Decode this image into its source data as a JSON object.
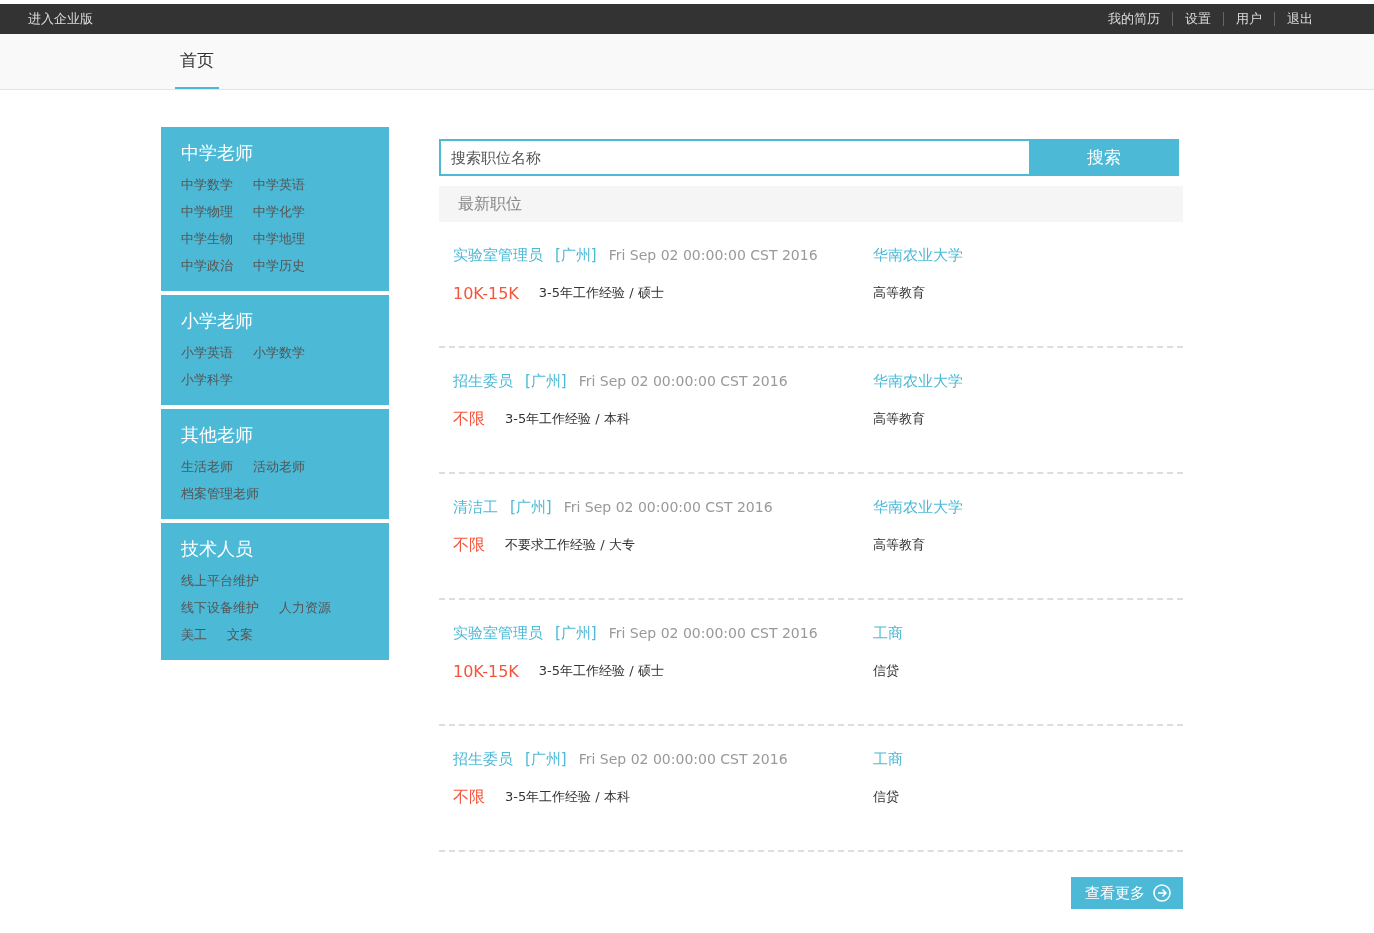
{
  "top_bar": {
    "left_link": "进入企业版",
    "links": [
      "我的简历",
      "设置",
      "用户",
      "退出"
    ]
  },
  "nav_tabs": [
    {
      "label": "首页",
      "selected": true
    }
  ],
  "categories": [
    {
      "title": "中学老师",
      "lines": [
        {
          "links": [
            "中学数学",
            "中学英语"
          ]
        },
        {
          "links": [
            "中学物理",
            "中学化学"
          ]
        },
        {
          "links": [
            "中学生物",
            "中学地理"
          ]
        },
        {
          "links": [
            "中学政治",
            "中学历史"
          ]
        }
      ]
    },
    {
      "title": "小学老师",
      "lines": [
        {
          "links": [
            "小学英语",
            "小学数学"
          ]
        },
        {
          "links": [
            "小学科学"
          ]
        }
      ]
    },
    {
      "title": "其他老师",
      "lines": [
        {
          "links": [
            "生活老师",
            "活动老师"
          ]
        },
        {
          "links": [
            "档案管理老师"
          ]
        }
      ]
    },
    {
      "title": "技术人员",
      "lines": [
        {
          "links": [
            "线上平台维护"
          ]
        },
        {
          "links": [
            "线下设备维护",
            "人力资源"
          ]
        },
        {
          "links": [
            "美工",
            "文案"
          ]
        }
      ]
    }
  ],
  "search": {
    "placeholder": "搜索职位名称",
    "button": "搜索"
  },
  "section_title": "最新职位",
  "jobs": [
    {
      "title": "实验室管理员",
      "city": "[广州]",
      "date": "Fri Sep 02 00:00:00 CST 2016",
      "company": "华南农业大学",
      "salary": "10K-15K",
      "requirements": "3-5年工作经验 / 硕士",
      "industry": "高等教育"
    },
    {
      "title": "招生委员",
      "city": "[广州]",
      "date": "Fri Sep 02 00:00:00 CST 2016",
      "company": "华南农业大学",
      "salary": "不限",
      "requirements": "3-5年工作经验 / 本科",
      "industry": "高等教育"
    },
    {
      "title": "清洁工",
      "city": "[广州]",
      "date": "Fri Sep 02 00:00:00 CST 2016",
      "company": "华南农业大学",
      "salary": "不限",
      "requirements": "不要求工作经验 / 大专",
      "industry": "高等教育"
    },
    {
      "title": "实验室管理员",
      "city": "[广州]",
      "date": "Fri Sep 02 00:00:00 CST 2016",
      "company": "工商",
      "salary": "10K-15K",
      "requirements": "3-5年工作经验 / 硕士",
      "industry": "信贷"
    },
    {
      "title": "招生委员",
      "city": "[广州]",
      "date": "Fri Sep 02 00:00:00 CST 2016",
      "company": "工商",
      "salary": "不限",
      "requirements": "3-5年工作经验 / 本科",
      "industry": "信贷"
    }
  ],
  "more_button": "查看更多"
}
